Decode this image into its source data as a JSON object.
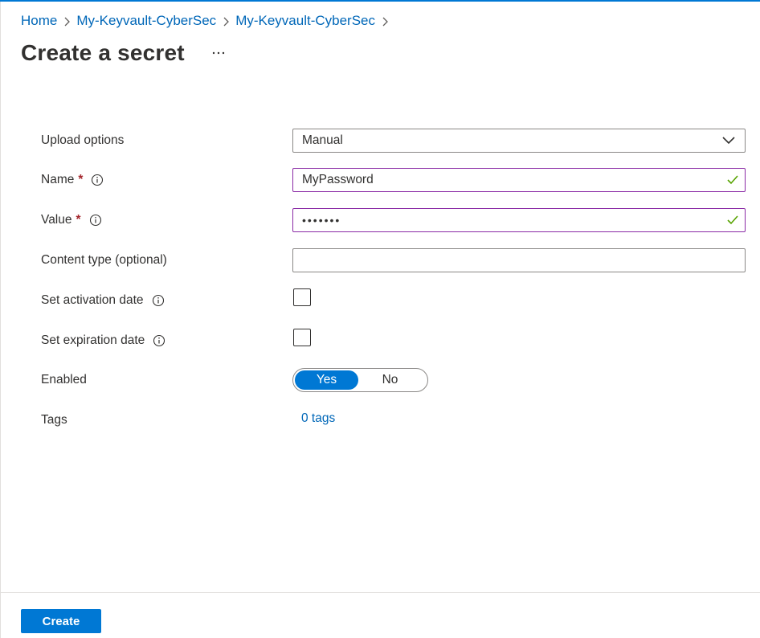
{
  "breadcrumb": {
    "items": [
      "Home",
      "My-Keyvault-CyberSec",
      "My-Keyvault-CyberSec"
    ]
  },
  "page": {
    "title": "Create a secret",
    "more_label": "···"
  },
  "form": {
    "upload_options": {
      "label": "Upload options",
      "value": "Manual"
    },
    "name": {
      "label": "Name",
      "required_mark": "*",
      "value": "MyPassword"
    },
    "value": {
      "label": "Value",
      "required_mark": "*",
      "value": "•••••••"
    },
    "content_type": {
      "label": "Content type (optional)",
      "value": ""
    },
    "activation_date": {
      "label": "Set activation date",
      "checked": false
    },
    "expiration_date": {
      "label": "Set expiration date",
      "checked": false
    },
    "enabled": {
      "label": "Enabled",
      "options": [
        "Yes",
        "No"
      ],
      "selected": "Yes"
    },
    "tags": {
      "label": "Tags",
      "link": "0 tags"
    }
  },
  "footer": {
    "create_label": "Create"
  },
  "colors": {
    "accent": "#0078d4",
    "link": "#0067b8",
    "required": "#a4262c",
    "valid_check": "#57a300",
    "valid_border": "#8a2aa5"
  }
}
